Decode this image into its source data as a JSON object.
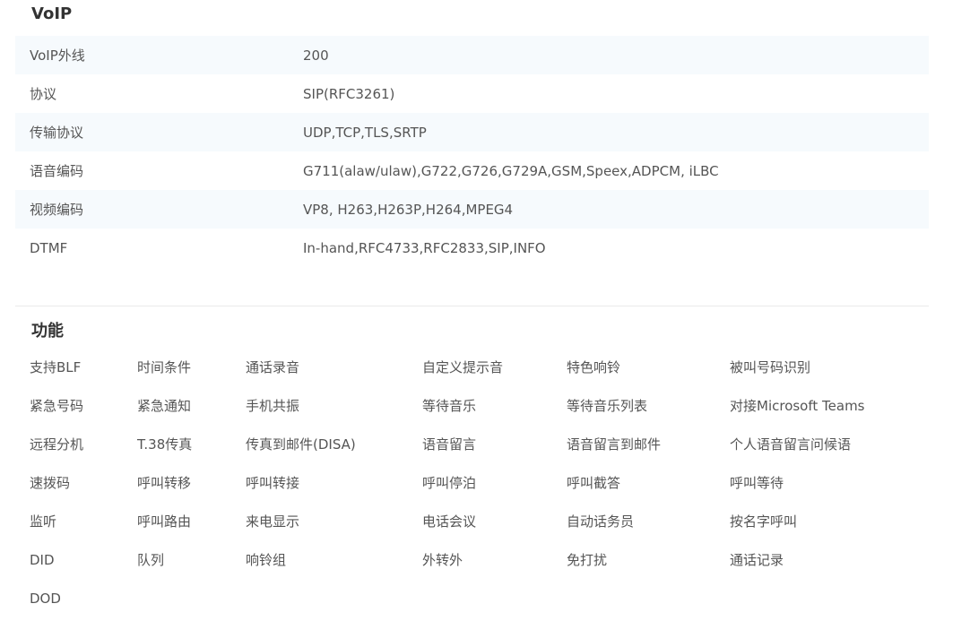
{
  "voip": {
    "title": "VoIP",
    "rows": [
      {
        "label": "VoIP外线",
        "value": "200"
      },
      {
        "label": "协议",
        "value": "SIP(RFC3261)"
      },
      {
        "label": "传输协议",
        "value": "UDP,TCP,TLS,SRTP"
      },
      {
        "label": "语音编码",
        "value": "G711(alaw/ulaw),G722,G726,G729A,GSM,Speex,ADPCM, iLBC"
      },
      {
        "label": "视频编码",
        "value": "VP8, H263,H263P,H264,MPEG4"
      },
      {
        "label": "DTMF",
        "value": "In-hand,RFC4733,RFC2833,SIP,INFO"
      }
    ]
  },
  "features": {
    "title": "功能",
    "rows": [
      [
        "支持BLF",
        "时间条件",
        "通话录音",
        "自定义提示音",
        "特色响铃",
        "被叫号码识别"
      ],
      [
        "紧急号码",
        "紧急通知",
        "手机共振",
        "等待音乐",
        "等待音乐列表",
        "对接Microsoft Teams"
      ],
      [
        "远程分机",
        "T.38传真",
        "传真到邮件(DISA)",
        "语音留言",
        "语音留言到邮件",
        "个人语音留言问候语"
      ],
      [
        "速拨码",
        "呼叫转移",
        "呼叫转接",
        "呼叫停泊",
        "呼叫截答",
        "呼叫等待"
      ],
      [
        "监听",
        "呼叫路由",
        "来电显示",
        "电话会议",
        "自动话务员",
        "按名字呼叫"
      ],
      [
        "DID",
        "队列",
        "响铃组",
        "外转外",
        "免打扰",
        "通话记录"
      ],
      [
        "DOD"
      ]
    ]
  }
}
